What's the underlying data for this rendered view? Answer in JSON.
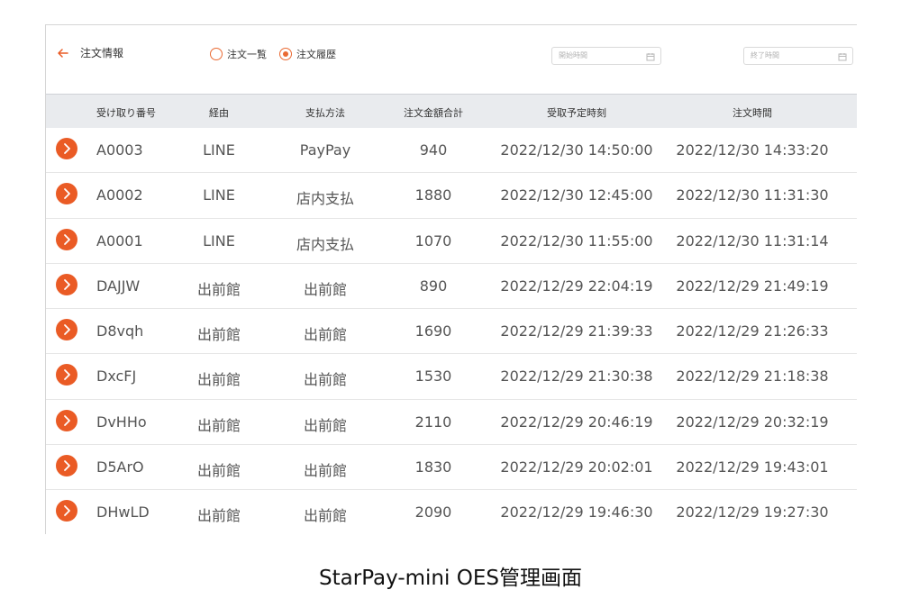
{
  "header": {
    "title": "注文情報",
    "radio_list": "注文一覧",
    "radio_history": "注文履歴",
    "start_placeholder": "開始時間",
    "end_placeholder": "終了時間"
  },
  "table": {
    "columns": [
      "受け取り番号",
      "経由",
      "支払方法",
      "注文金額合計",
      "受取予定時刻",
      "注文時間"
    ],
    "rows": [
      [
        "A0003",
        "LINE",
        "PayPay",
        "940",
        "2022/12/30 14:50:00",
        "2022/12/30 14:33:20"
      ],
      [
        "A0002",
        "LINE",
        "店内支払",
        "1880",
        "2022/12/30 12:45:00",
        "2022/12/30 11:31:30"
      ],
      [
        "A0001",
        "LINE",
        "店内支払",
        "1070",
        "2022/12/30 11:55:00",
        "2022/12/30 11:31:14"
      ],
      [
        "DAJJW",
        "出前館",
        "出前館",
        "890",
        "2022/12/29 22:04:19",
        "2022/12/29 21:49:19"
      ],
      [
        "D8vqh",
        "出前館",
        "出前館",
        "1690",
        "2022/12/29 21:39:33",
        "2022/12/29 21:26:33"
      ],
      [
        "DxcFJ",
        "出前館",
        "出前館",
        "1530",
        "2022/12/29 21:30:38",
        "2022/12/29 21:18:38"
      ],
      [
        "DvHHo",
        "出前館",
        "出前館",
        "2110",
        "2022/12/29 20:46:19",
        "2022/12/29 20:32:19"
      ],
      [
        "D5ArO",
        "出前館",
        "出前館",
        "1830",
        "2022/12/29 20:02:01",
        "2022/12/29 19:43:01"
      ],
      [
        "DHwLD",
        "出前館",
        "出前館",
        "2090",
        "2022/12/29 19:46:30",
        "2022/12/29 19:27:30"
      ]
    ]
  },
  "caption": "StarPay-mini OES管理画面",
  "colors": {
    "accent": "#ea5b25",
    "header_bg": "#e9ebee"
  },
  "icons": {
    "back": "arrow-left-icon",
    "calendar": "calendar-icon",
    "row_action": "chevron-right-icon"
  }
}
